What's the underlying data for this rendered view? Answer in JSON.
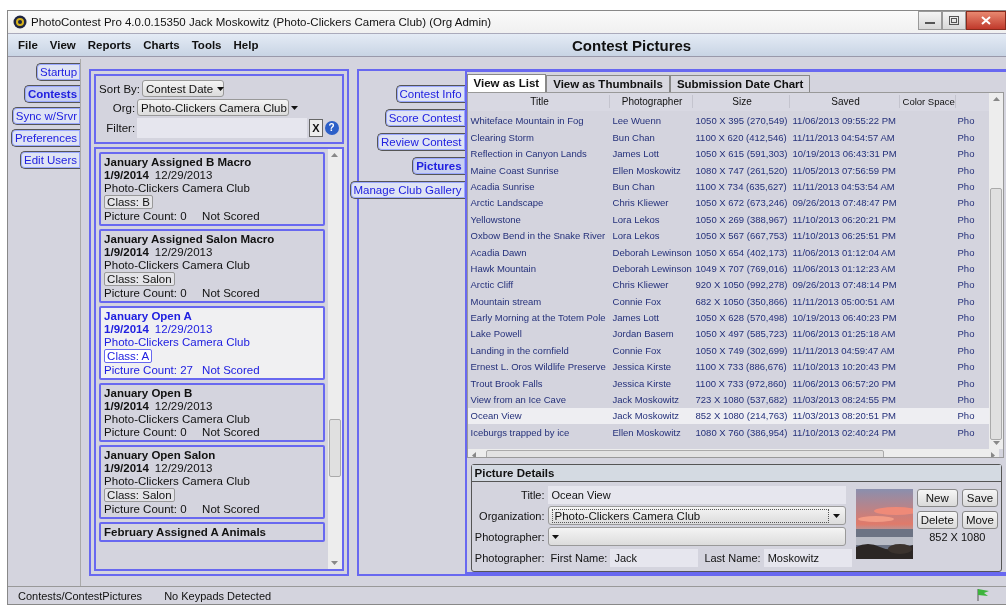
{
  "window": {
    "title": "PhotoContest Pro 4.0.0.15350 Jack Moskowitz (Photo-Clickers Camera Club) (Org Admin)"
  },
  "menu": [
    "File",
    "View",
    "Reports",
    "Charts",
    "Tools",
    "Help"
  ],
  "header_title": "Contest Pictures",
  "nav_tabs": [
    {
      "label": "Startup",
      "selected": false
    },
    {
      "label": "Contests",
      "selected": true
    },
    {
      "label": "Sync w/Srvr",
      "selected": false
    },
    {
      "label": "Preferences",
      "selected": false
    },
    {
      "label": "Edit Users",
      "selected": false
    }
  ],
  "filters": {
    "sort_label": "Sort By:",
    "sort_value": "Contest Date",
    "org_label": "Org:",
    "org_value": "Photo-Clickers Camera Club",
    "filter_label": "Filter:",
    "clear_button": "X",
    "help_button": "?"
  },
  "contests": [
    {
      "name": "January Assigned B Macro",
      "date": "1/9/2014",
      "date2": "12/29/2013",
      "org": "Photo-Clickers Camera Club",
      "class": "Class: B",
      "count": "Picture Count: 0",
      "status": "Not Scored",
      "selected": false
    },
    {
      "name": "January Assigned Salon Macro",
      "date": "1/9/2014",
      "date2": "12/29/2013",
      "org": "Photo-Clickers Camera Club",
      "class": "Class: Salon",
      "count": "Picture Count: 0",
      "status": "Not Scored",
      "selected": false
    },
    {
      "name": "January Open A",
      "date": "1/9/2014",
      "date2": "12/29/2013",
      "org": "Photo-Clickers Camera Club",
      "class": "Class: A",
      "count": "Picture Count: 27",
      "status": "Not Scored",
      "selected": true
    },
    {
      "name": "January Open B",
      "date": "1/9/2014",
      "date2": "12/29/2013",
      "org": "Photo-Clickers Camera Club",
      "count": "Picture Count: 0",
      "status": "Not Scored",
      "selected": false
    },
    {
      "name": "January Open Salon",
      "date": "1/9/2014",
      "date2": "12/29/2013",
      "org": "Photo-Clickers Camera Club",
      "class": "Class: Salon",
      "count": "Picture Count: 0",
      "status": "Not Scored",
      "selected": false
    },
    {
      "name": "February Assigned A Animals",
      "selected": false
    }
  ],
  "contest_nav": [
    {
      "label": "Contest Info",
      "selected": false
    },
    {
      "label": "Score Contest",
      "selected": false
    },
    {
      "label": "Review Contest",
      "selected": false
    },
    {
      "label": "Pictures",
      "selected": true
    },
    {
      "label": "Manage Club Gallery",
      "selected": false
    }
  ],
  "view_tabs": [
    {
      "label": "View as List",
      "selected": true
    },
    {
      "label": "View as Thumbnails",
      "selected": false
    },
    {
      "label": "Submission Date Chart",
      "selected": false
    }
  ],
  "table": {
    "columns": [
      "Title",
      "Photographer",
      "Size",
      "Saved",
      "Color Space"
    ],
    "rows": [
      {
        "cells": [
          "Whiteface Mountain in Fog",
          "Lee Wuenn",
          "1050 X 395 (270,549)",
          "11/06/2013 09:55:22 PM",
          "",
          "Pho"
        ],
        "selected": false
      },
      {
        "cells": [
          "Clearing Storm",
          "Bun Chan",
          "1100 X 620 (412,546)",
          "11/11/2013 04:54:57 AM",
          "",
          "Pho"
        ],
        "selected": false
      },
      {
        "cells": [
          "Reflection in Canyon Lands",
          "James Lott",
          "1050 X 615 (591,303)",
          "10/19/2013 06:43:31 PM",
          "",
          "Pho"
        ],
        "selected": false
      },
      {
        "cells": [
          "Maine Coast Sunrise",
          "Ellen Moskowitz",
          "1080 X 747 (261,520)",
          "11/05/2013 07:56:59 PM",
          "",
          "Pho"
        ],
        "selected": false
      },
      {
        "cells": [
          "Acadia Sunrise",
          "Bun Chan",
          "1100 X 734 (635,627)",
          "11/11/2013 04:53:54 AM",
          "",
          "Pho"
        ],
        "selected": false
      },
      {
        "cells": [
          "Arctic Landscape",
          "Chris Kliewer",
          "1050 X 672 (673,246)",
          "09/26/2013 07:48:47 PM",
          "",
          "Pho"
        ],
        "selected": false
      },
      {
        "cells": [
          "Yellowstone",
          "Lora Lekos",
          "1050 X 269 (388,967)",
          "11/10/2013 06:20:21 PM",
          "",
          "Pho"
        ],
        "selected": false
      },
      {
        "cells": [
          "Oxbow Bend in the Snake River",
          "Lora Lekos",
          "1050 X 567 (667,753)",
          "11/10/2013 06:25:51 PM",
          "",
          "Pho"
        ],
        "selected": false
      },
      {
        "cells": [
          "Acadia Dawn",
          "Deborah Lewinson",
          "1050 X 654 (402,173)",
          "11/06/2013 01:12:04 AM",
          "",
          "Pho"
        ],
        "selected": false
      },
      {
        "cells": [
          "Hawk Mountain",
          "Deborah Lewinson",
          "1049 X 707 (769,016)",
          "11/06/2013 01:12:23 AM",
          "",
          "Pho"
        ],
        "selected": false
      },
      {
        "cells": [
          "Arctic Cliff",
          "Chris Kliewer",
          "920 X 1050 (992,278)",
          "09/26/2013 07:48:14 PM",
          "",
          "Pho"
        ],
        "selected": false
      },
      {
        "cells": [
          "Mountain stream",
          "Connie Fox",
          "682 X 1050 (350,866)",
          "11/11/2013 05:00:51 AM",
          "",
          "Pho"
        ],
        "selected": false
      },
      {
        "cells": [
          "Early Morning at the Totem Pole",
          "James Lott",
          "1050 X 628 (570,498)",
          "10/19/2013 06:40:23 PM",
          "",
          "Pho"
        ],
        "selected": false
      },
      {
        "cells": [
          "Lake Powell",
          "Jordan Basem",
          "1050 X 497 (585,723)",
          "11/06/2013 01:25:18 AM",
          "",
          "Pho"
        ],
        "selected": false
      },
      {
        "cells": [
          "Landing in the cornfield",
          "Connie Fox",
          "1050 X 749 (302,699)",
          "11/11/2013 04:59:47 AM",
          "",
          "Pho"
        ],
        "selected": false
      },
      {
        "cells": [
          "Ernest L. Oros Wildlife Preserve",
          "Jessica Kirste",
          "1100 X 733 (886,676)",
          "11/10/2013 10:20:43 PM",
          "",
          "Pho"
        ],
        "selected": false
      },
      {
        "cells": [
          "Trout Brook Falls",
          "Jessica Kirste",
          "1100 X 733 (972,860)",
          "11/06/2013 06:57:20 PM",
          "",
          "Pho"
        ],
        "selected": false
      },
      {
        "cells": [
          "View from an Ice Cave",
          "Jack Moskowitz",
          "723 X 1080 (537,682)",
          "11/03/2013 08:24:55 PM",
          "",
          "Pho"
        ],
        "selected": false
      },
      {
        "cells": [
          "Ocean View",
          "Jack Moskowitz",
          "852 X 1080 (214,763)",
          "11/03/2013 08:20:51 PM",
          "",
          "Pho"
        ],
        "selected": true
      },
      {
        "cells": [
          "Iceburgs trapped by ice",
          "Ellen Moskowitz",
          "1080 X 760 (386,954)",
          "11/10/2013 02:40:24 PM",
          "",
          "Pho"
        ],
        "selected": false
      }
    ]
  },
  "details": {
    "heading": "Picture Details",
    "title_label": "Title:",
    "title_value": "Ocean View",
    "org_label": "Organization:",
    "org_value": "Photo-Clickers Camera Club",
    "photographer_label": "Photographer:",
    "photographer2_label": "Photographer:",
    "first_label": "First Name:",
    "first_value": "Jack",
    "last_label": "Last Name:",
    "last_value": "Moskowitz",
    "picture": {
      "kind": "picture"
    },
    "picture_size": "852 X 1080",
    "buttons": [
      "New",
      "Save",
      "Delete",
      "Move"
    ]
  },
  "status_bar": [
    "Contests/ContestPictures",
    "No Keypads Detected"
  ]
}
